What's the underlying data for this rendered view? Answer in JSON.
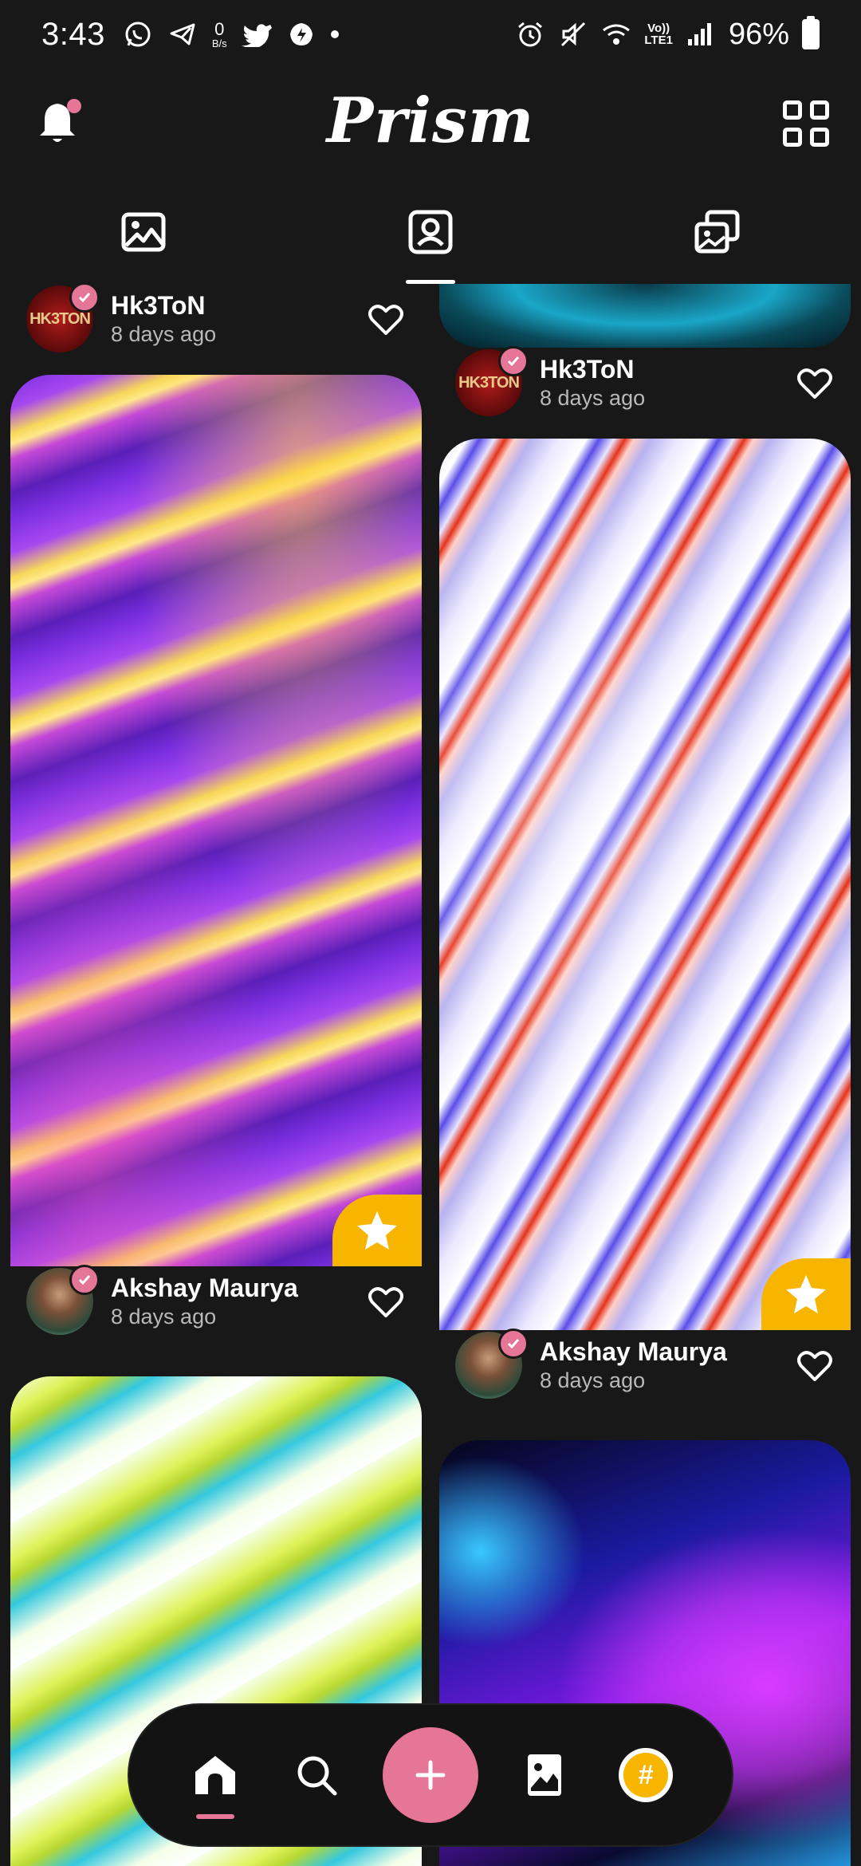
{
  "status_bar": {
    "time": "3:43",
    "net_speed_value": "0",
    "net_speed_unit": "B/s",
    "volte_top": "Vo))",
    "volte_bottom": "LTE1",
    "battery_percent": "96%"
  },
  "app": {
    "title": "Prism",
    "accent_color": "#e57697",
    "badge_color": "#f7b500"
  },
  "tabs": [
    {
      "name": "wallpapers",
      "icon": "image-icon",
      "active": false
    },
    {
      "name": "profile",
      "icon": "portrait-icon",
      "active": true
    },
    {
      "name": "collections",
      "icon": "photo-stack-icon",
      "active": false
    }
  ],
  "feed": {
    "left": [
      {
        "author": "Hk3ToN",
        "time": "8 days ago",
        "avatar_text": "HK3TON"
      },
      {
        "author": "Akshay Maurya",
        "time": "8 days ago"
      }
    ],
    "right": [
      {
        "author": "Hk3ToN",
        "time": "8 days ago",
        "avatar_text": "HK3TON"
      },
      {
        "author": "Akshay Maurya",
        "time": "8 days ago"
      }
    ]
  },
  "bottom_nav": {
    "items": [
      "home-icon",
      "search-icon",
      "add-icon",
      "image-icon",
      "hashtag-icon"
    ],
    "hash_symbol": "#",
    "add_symbol": "+"
  }
}
